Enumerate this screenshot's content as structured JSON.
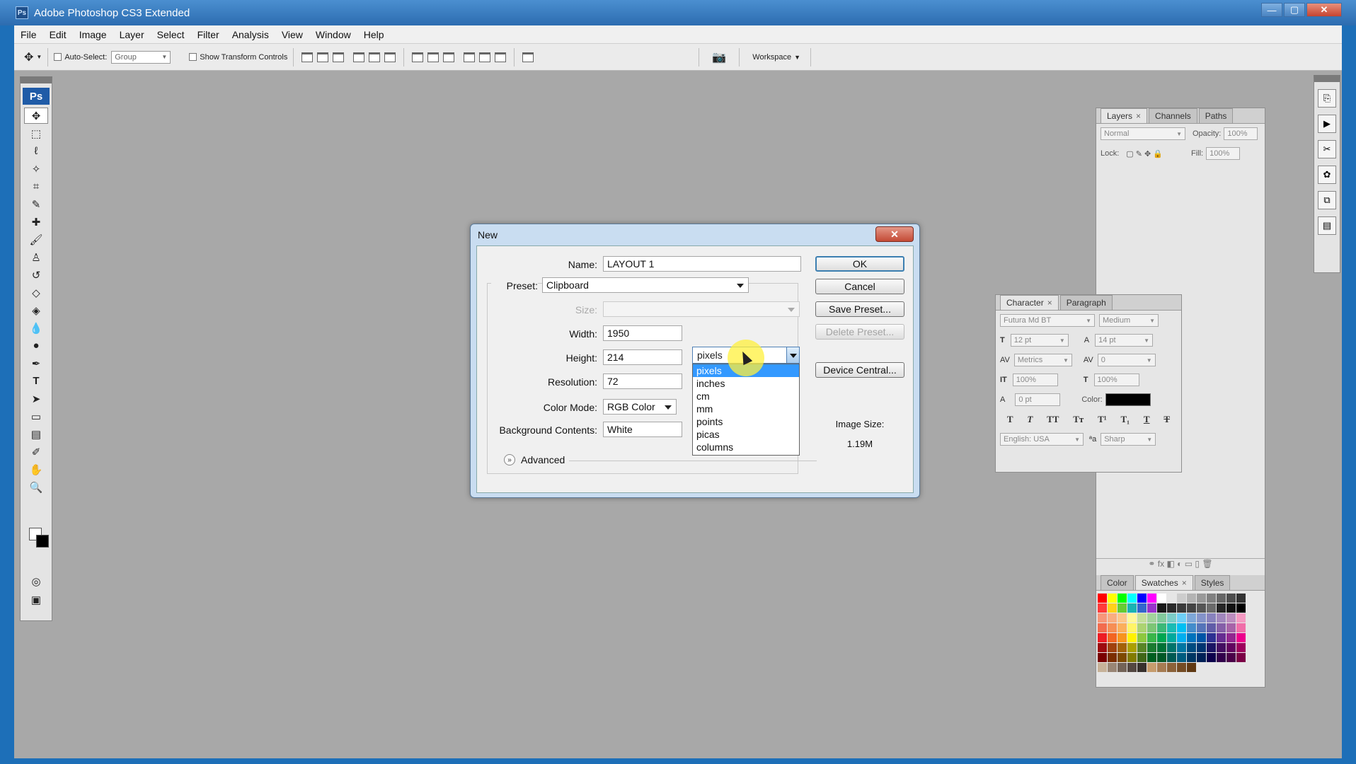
{
  "window": {
    "title": "Adobe Photoshop CS3 Extended",
    "app_icon": "Ps"
  },
  "menu": [
    "File",
    "Edit",
    "Image",
    "Layer",
    "Select",
    "Filter",
    "Analysis",
    "View",
    "Window",
    "Help"
  ],
  "options_bar": {
    "auto_select_label": "Auto-Select:",
    "auto_select_value": "Group",
    "show_transform_label": "Show Transform Controls",
    "workspace_label": "Workspace"
  },
  "toolbox": {
    "logo": "Ps"
  },
  "dialog": {
    "title": "New",
    "name_label": "Name:",
    "name_value": "LAYOUT 1",
    "preset_label": "Preset:",
    "preset_value": "Clipboard",
    "size_label": "Size:",
    "size_value": "",
    "width_label": "Width:",
    "width_value": "1950",
    "height_label": "Height:",
    "height_value": "214",
    "resolution_label": "Resolution:",
    "resolution_value": "72",
    "color_mode_label": "Color Mode:",
    "color_mode_value": "RGB Color",
    "bg_label": "Background Contents:",
    "bg_value": "White",
    "advanced_label": "Advanced",
    "image_size_label": "Image Size:",
    "image_size_value": "1.19M",
    "buttons": {
      "ok": "OK",
      "cancel": "Cancel",
      "save_preset": "Save Preset...",
      "delete_preset": "Delete Preset...",
      "device_central": "Device Central..."
    },
    "unit_dropdown": {
      "selected": "pixels",
      "options": [
        "pixels",
        "inches",
        "cm",
        "mm",
        "points",
        "picas",
        "columns"
      ]
    }
  },
  "layers_panel": {
    "tabs": [
      "Layers",
      "Channels",
      "Paths"
    ],
    "blend": "Normal",
    "opacity_label": "Opacity:",
    "opacity": "100%",
    "lock_label": "Lock:",
    "fill_label": "Fill:",
    "fill": "100%"
  },
  "character_panel": {
    "tabs": [
      "Character",
      "Paragraph"
    ],
    "font": "Futura Md BT",
    "style": "Medium",
    "size": "12 pt",
    "leading": "14 pt",
    "kerning": "Metrics",
    "tracking": "0",
    "vscale": "100%",
    "hscale": "100%",
    "baseline": "0 pt",
    "color_label": "Color:",
    "language": "English: USA",
    "antialias": "Sharp"
  },
  "swatch_panel": {
    "tabs": [
      "Color",
      "Swatches",
      "Styles"
    ]
  }
}
